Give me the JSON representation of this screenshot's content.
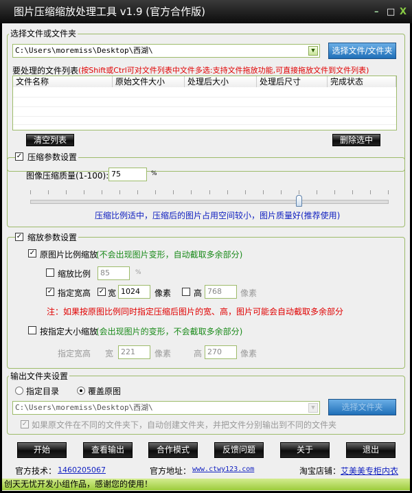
{
  "window": {
    "title": "图片压缩缩放处理工具 v1.9 (官方合作版)",
    "minimize": "–",
    "maximize": "□",
    "close": "X"
  },
  "file_group": {
    "legend": "选择文件或文件夹",
    "path": "C:\\Users\\moremiss\\Desktop\\西湖\\",
    "select_button": "选择文件/文件夹",
    "list_label": "要处理的文件列表",
    "list_hint": "(按Shift或Ctrl可对文件列表中文件多选:支持文件拖放功能,可直接拖放文件到文件列表)",
    "columns": [
      "文件名称",
      "原始文件大小",
      "处理后大小",
      "处理后尺寸",
      "完成状态"
    ],
    "clear_button": "清空列表",
    "delete_button": "删除选中"
  },
  "compress_group": {
    "legend": "压缩参数设置",
    "enabled": true,
    "quality_label": "图像压缩质量(1-100):",
    "quality_value": "75",
    "unit": "%",
    "slider_value": 75,
    "slider_min": 0,
    "slider_max": 100,
    "hint": "压缩比例适中，压缩后的图片占用空间较小，图片质量好(推荐使用)"
  },
  "scale_group": {
    "legend": "缩放参数设置",
    "enabled": true,
    "proportional": {
      "label": "原图片比例缩放",
      "hint": "(不会出现图片变形，自动截取多余部分)",
      "checked": true
    },
    "ratio": {
      "label": "缩放比例",
      "value": "85",
      "unit": "%",
      "checked": false
    },
    "size": {
      "label": "指定宽高",
      "checked": true,
      "width_label": "宽",
      "width_checked": true,
      "width_value": "1024",
      "height_label": "高",
      "height_checked": false,
      "height_value": "768",
      "unit": "像素"
    },
    "note": "注：如果按原图比例同时指定压缩后图片的宽、高，图片可能会自动截取多余部分",
    "fixed": {
      "label": "按指定大小缩放",
      "hint": "(会出现图片的变形，不会截取多余部分)",
      "checked": false,
      "size_label": "指定宽高",
      "width_label": "宽",
      "width_value": "221",
      "height_label": "高",
      "height_value": "270",
      "unit": "像素"
    }
  },
  "output_group": {
    "legend": "输出文件夹设置",
    "radio_dir": "指定目录",
    "radio_overwrite": "覆盖原图",
    "path": "C:\\Users\\moremiss\\Desktop\\西湖\\",
    "select_button": "选择文件夹",
    "subfolder_label": "如果原文件在不同的文件夹下，自动创建文件夹，并把文件分别输出到不同的文件夹"
  },
  "actions": [
    "开始",
    "查看输出",
    "合作模式",
    "反馈问题",
    "关于",
    "退出"
  ],
  "footer": {
    "tech_label": "官方技术：",
    "tech_link": "1460205067",
    "site_label": "官方地址：",
    "site_link": "www.ctwy123.com",
    "shop_label": "淘宝店铺：",
    "shop_link": "艾美美专柜内衣"
  },
  "status": "创天无忧开发小组作品，感谢您的使用！"
}
